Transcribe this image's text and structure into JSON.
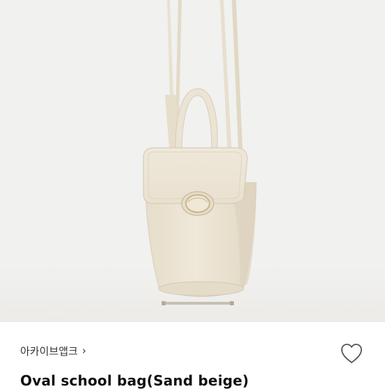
{
  "product": {
    "brand_label": "아카이브앱크",
    "title": "Oval school bag(Sand beige)",
    "image_alt": "product-photo"
  },
  "icons": {
    "brand_chevron": "chevron-right-icon",
    "like": "heart-outline-icon"
  },
  "colors": {
    "photo_background": "#f1f1ef",
    "bag": "#ebe3d3",
    "text_primary": "#111111"
  }
}
